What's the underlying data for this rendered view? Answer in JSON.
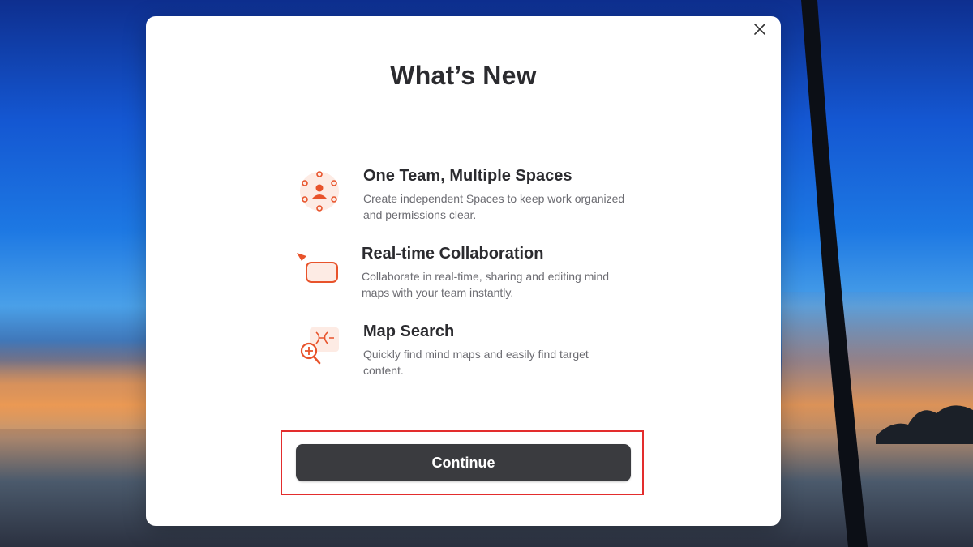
{
  "modal": {
    "title": "What’s New",
    "close_icon": "close-icon",
    "features": [
      {
        "icon": "team-spaces-icon",
        "heading": "One Team, Multiple Spaces",
        "description": "Create independent Spaces to keep work organized and permissions clear."
      },
      {
        "icon": "collaboration-cursor-icon",
        "heading": "Real-time Collaboration",
        "description": "Collaborate in real-time, sharing and editing mind maps with your team instantly."
      },
      {
        "icon": "map-search-icon",
        "heading": "Map Search",
        "description": "Quickly find mind maps and easily find target content."
      }
    ],
    "continue_label": "Continue"
  },
  "colors": {
    "accent": "#e8532b",
    "button_bg": "#3a3b3f",
    "highlight_border": "#e32d2d"
  }
}
